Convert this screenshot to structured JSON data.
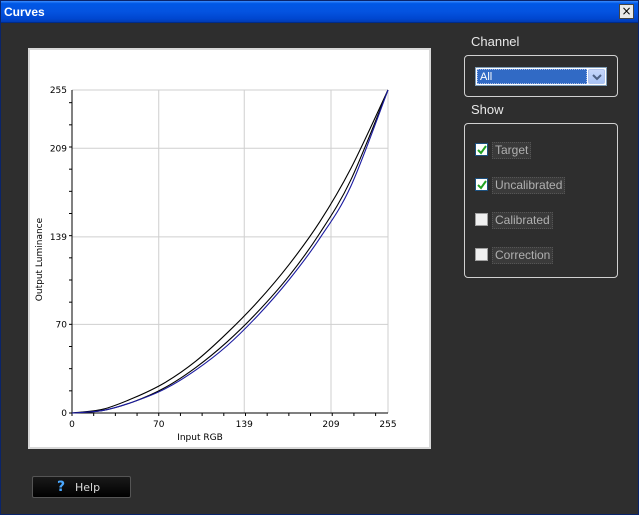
{
  "window": {
    "title": "Curves",
    "close_glyph": "×"
  },
  "channel": {
    "label": "Channel",
    "selected": "All"
  },
  "show": {
    "label": "Show",
    "options": [
      {
        "label": "Target",
        "checked": true,
        "enabled": true
      },
      {
        "label": "Uncalibrated",
        "checked": true,
        "enabled": true
      },
      {
        "label": "Calibrated",
        "checked": false,
        "enabled": false
      },
      {
        "label": "Correction",
        "checked": false,
        "enabled": false
      }
    ]
  },
  "help": {
    "label": "Help",
    "icon": "question-icon",
    "glyph": "?"
  },
  "chart_data": {
    "type": "line",
    "xlabel": "Input RGB",
    "ylabel": "Output Luminance",
    "xlim": [
      0,
      255
    ],
    "ylim": [
      0,
      255
    ],
    "x_ticks": [
      0,
      70,
      139,
      209,
      255
    ],
    "y_ticks": [
      0,
      70,
      139,
      209,
      255
    ],
    "x_tick_labels": [
      "0",
      "70",
      "139",
      "209",
      "255"
    ],
    "y_tick_labels": [
      "0",
      "70",
      "139",
      "209",
      "255"
    ],
    "grid": true,
    "series": [
      {
        "color": "#000000",
        "x": [
          0,
          25,
          50,
          75,
          100,
          125,
          150,
          175,
          200,
          225,
          255
        ],
        "y": [
          0,
          2,
          9,
          20,
          36,
          56,
          80,
          108,
          142,
          184,
          255
        ]
      },
      {
        "color": "#000000",
        "x": [
          0,
          25,
          50,
          75,
          100,
          125,
          150,
          175,
          200,
          225,
          255
        ],
        "y": [
          0,
          3,
          12,
          24,
          41,
          63,
          88,
          117,
          151,
          193,
          255
        ]
      },
      {
        "color": "#1a1aa0",
        "x": [
          0,
          25,
          50,
          75,
          100,
          125,
          150,
          175,
          200,
          225,
          255
        ],
        "y": [
          0,
          2,
          9,
          19,
          34,
          53,
          77,
          105,
          138,
          179,
          255
        ]
      }
    ]
  }
}
